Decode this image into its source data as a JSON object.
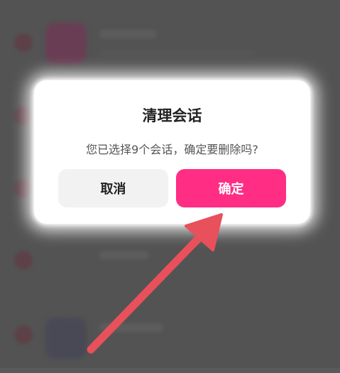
{
  "dialog": {
    "title": "清理会话",
    "message": "您已选择9个会话，确定要删除吗?",
    "cancel_label": "取消",
    "confirm_label": "确定"
  },
  "colors": {
    "confirm_button": "#ff2d84",
    "cancel_button": "#f2f2f2",
    "annotation_arrow": "#e8505b"
  },
  "icons": {
    "annotation": "arrow-pointer-icon"
  }
}
